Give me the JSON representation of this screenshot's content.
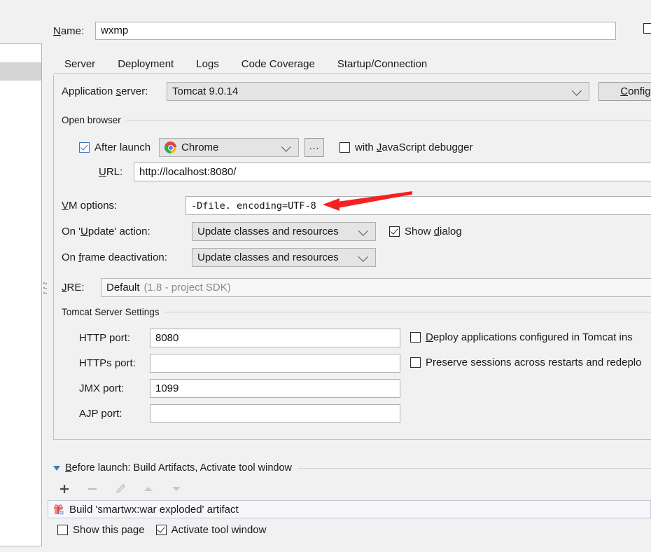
{
  "window": {
    "name_label": "Name:",
    "name_value": "wxmp",
    "share_checkbox_name": "share-checkbox"
  },
  "tabs": [
    {
      "label": "Server",
      "active": true
    },
    {
      "label": "Deployment",
      "active": false
    },
    {
      "label": "Logs",
      "active": false
    },
    {
      "label": "Code Coverage",
      "active": false
    },
    {
      "label": "Startup/Connection",
      "active": false
    }
  ],
  "server": {
    "app_server_label": "Application server:",
    "app_server_value": "Tomcat 9.0.14",
    "configure_button": "Configure...",
    "open_browser_group": "Open browser",
    "after_launch_label": "After launch",
    "after_launch_checked": true,
    "browser_value": "Chrome",
    "browser_ellipsis": "...",
    "js_debugger_label": "with JavaScript debugger",
    "js_debugger_checked": false,
    "url_label": "URL:",
    "url_value": "http://localhost:8080/",
    "vm_options_label": "VM options:",
    "vm_options_value": "-Dfile. encoding=UTF-8",
    "on_update_label": "On 'Update' action:",
    "on_update_value": "Update classes and resources",
    "show_dialog_label": "Show dialog",
    "show_dialog_checked": true,
    "on_frame_label": "On frame deactivation:",
    "on_frame_value": "Update classes and resources",
    "jre_label": "JRE:",
    "jre_value": "Default",
    "jre_hint": "(1.8 - project SDK)",
    "tomcat_group": "Tomcat Server Settings",
    "ports": [
      {
        "label": "HTTP port:",
        "value": "8080"
      },
      {
        "label": "HTTPs port:",
        "value": ""
      },
      {
        "label": "JMX port:",
        "value": "1099"
      },
      {
        "label": "AJP port:",
        "value": ""
      }
    ],
    "deploy_apps_label": "Deploy applications configured in Tomcat ins",
    "deploy_apps_checked": false,
    "preserve_sessions_label": "Preserve sessions across restarts and redeplo",
    "preserve_sessions_checked": false
  },
  "before_launch": {
    "title": "Before launch: Build Artifacts, Activate tool window",
    "toolbar": [
      "add",
      "remove",
      "edit",
      "move-up",
      "move-down"
    ],
    "artifact_item": "Build 'smartwx:war exploded' artifact",
    "show_this_page_label": "Show this page",
    "show_this_page_checked": false,
    "activate_tool_window_label": "Activate tool window",
    "activate_tool_window_checked": true
  },
  "annotation": {
    "arrow_color": "#f42222",
    "points_at": "vm-options-input"
  },
  "colors": {
    "accent": "#3d7ab8",
    "panel_bg": "#f1f1f1",
    "field_bg": "#ffffff",
    "combo_bg": "#e4e4e4",
    "border": "#b0b0b0",
    "selected_row": "#d4d4d4"
  }
}
